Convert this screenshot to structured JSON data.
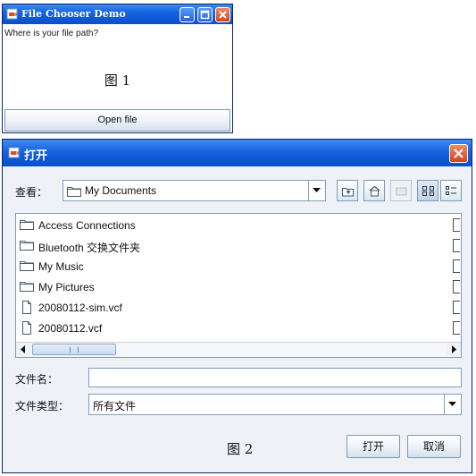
{
  "window1": {
    "title": "File Chooser Demo",
    "prompt": "Where is your file path?",
    "figure_label": "图 1",
    "open_button": "Open file"
  },
  "window2": {
    "title": "打开",
    "look_in_label": "查看：",
    "look_in_value": "My Documents",
    "files": [
      {
        "name": "Access Connections",
        "icon": "folder-icon"
      },
      {
        "name": "Bluetooth 交换文件夹",
        "icon": "folder-icon"
      },
      {
        "name": "My Music",
        "icon": "folder-icon"
      },
      {
        "name": "My Pictures",
        "icon": "folder-icon"
      },
      {
        "name": "20080112-sim.vcf",
        "icon": "file-icon"
      },
      {
        "name": "20080112.vcf",
        "icon": "file-icon"
      }
    ],
    "file_name_label": "文件名：",
    "file_name_value": "",
    "file_type_label": "文件类型：",
    "file_type_value": "所有文件",
    "figure_label": "图 2",
    "open_button": "打开",
    "cancel_button": "取消"
  },
  "colors": {
    "titlebar": "#1662e0",
    "close_button": "#d2431c",
    "dialog_background": "#eef2f7"
  }
}
